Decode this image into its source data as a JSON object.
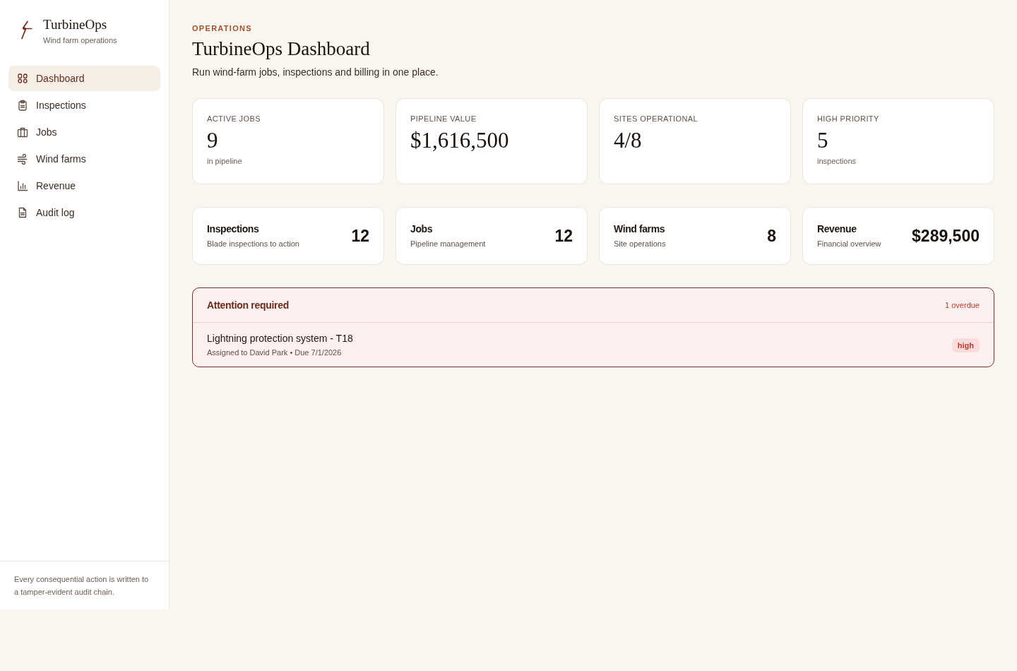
{
  "brand": {
    "name": "TurbineOps",
    "tagline": "Wind farm operations"
  },
  "sidebar": {
    "items": [
      {
        "label": "Dashboard",
        "selected": true
      },
      {
        "label": "Inspections",
        "selected": false
      },
      {
        "label": "Jobs",
        "selected": false
      },
      {
        "label": "Wind farms",
        "selected": false
      },
      {
        "label": "Revenue",
        "selected": false
      },
      {
        "label": "Audit log",
        "selected": false
      }
    ],
    "footer": "Every consequential action is written to a tamper-evident audit chain."
  },
  "header": {
    "eyebrow": "OPERATIONS",
    "title": "TurbineOps Dashboard",
    "subtitle": "Run wind-farm jobs, inspections and billing in one place."
  },
  "stats": [
    {
      "label": "ACTIVE JOBS",
      "value": "9",
      "note": "in pipeline"
    },
    {
      "label": "PIPELINE VALUE",
      "value": "$1,616,500"
    },
    {
      "label": "SITES OPERATIONAL",
      "value": "4/8"
    },
    {
      "label": "HIGH PRIORITY",
      "value": "5",
      "note": "inspections"
    }
  ],
  "modules": [
    {
      "title": "Inspections",
      "subtitle": "Blade inspections to action",
      "count": "12"
    },
    {
      "title": "Jobs",
      "subtitle": "Pipeline management",
      "count": "12"
    },
    {
      "title": "Wind farms",
      "subtitle": "Site operations",
      "count": "8"
    },
    {
      "title": "Revenue",
      "subtitle": "Financial overview",
      "count": "$289,500"
    }
  ],
  "attention": {
    "title": "Attention required",
    "count": "1 overdue",
    "items": [
      {
        "title": "Lightning protection system - T18",
        "meta": "Assigned to David Park • Due 7/1/2026",
        "priority": "high"
      }
    ]
  }
}
